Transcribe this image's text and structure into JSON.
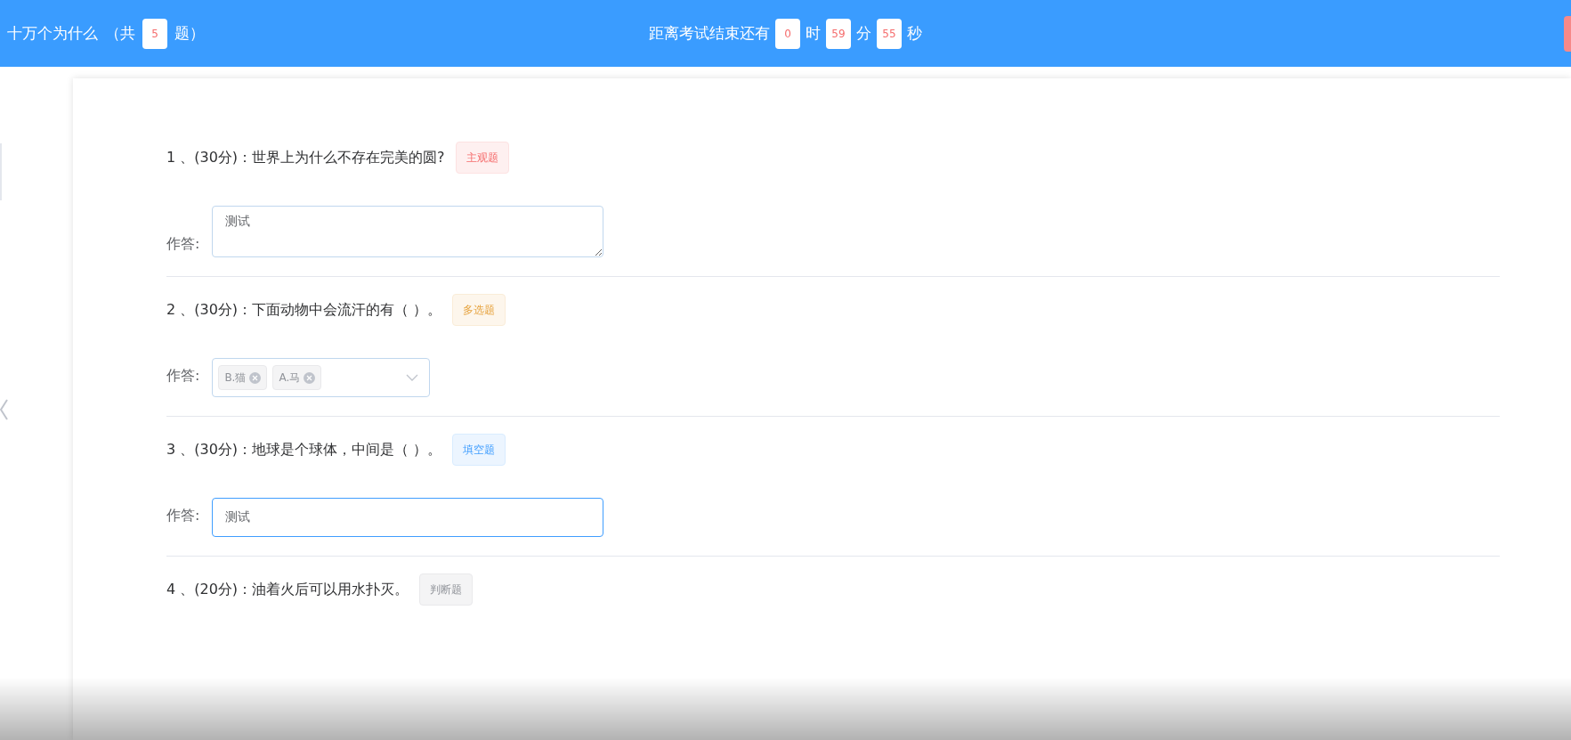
{
  "header": {
    "title": "十万个为什么",
    "count_prefix": "（共",
    "count": "5",
    "count_suffix": "题）",
    "timer": {
      "label": "距离考试结束还有",
      "parts": [
        {
          "value": "0",
          "unit": "时"
        },
        {
          "value": "59",
          "unit": "分"
        },
        {
          "value": "55",
          "unit": "秒"
        }
      ]
    }
  },
  "questions": [
    {
      "title": "1 、(30分)：世界上为什么不存在完美的圆?",
      "tag": {
        "label": "主观题",
        "kind": "subjective"
      },
      "answer": {
        "label": "作答:",
        "kind": "textarea",
        "value": "测试",
        "focused": false
      }
    },
    {
      "title": "2 、(30分)：下面动物中会流汗的有（ ）。",
      "tag": {
        "label": "多选题",
        "kind": "multiple"
      },
      "answer": {
        "label": "作答:",
        "kind": "select",
        "chips": [
          "B.猫",
          "A.马"
        ]
      }
    },
    {
      "title": "3 、(30分)：地球是个球体，中间是（ ）。",
      "tag": {
        "label": "填空题",
        "kind": "blank"
      },
      "answer": {
        "label": "作答:",
        "kind": "input",
        "value": "测试",
        "focused": true
      }
    },
    {
      "title": "4 、(20分)：油着火后可以用水扑灭。",
      "tag": {
        "label": "判断题",
        "kind": "judge"
      }
    }
  ]
}
